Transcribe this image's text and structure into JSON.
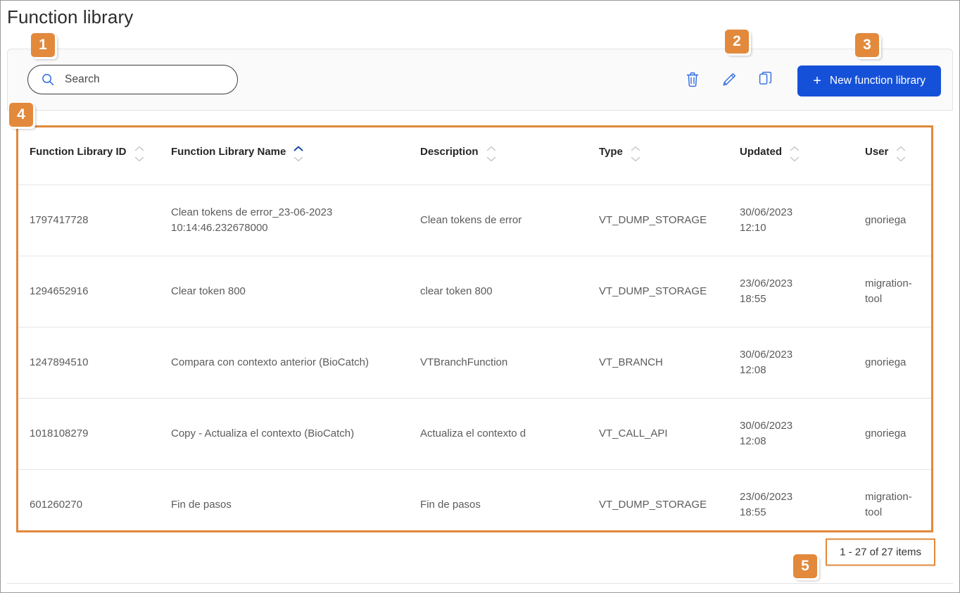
{
  "page": {
    "title": "Function library"
  },
  "colors": {
    "accent_orange": "#e2893c",
    "primary_blue": "#1551d8",
    "icon_blue": "#2d6ae0",
    "text_dark": "#2c2c2c",
    "text_body": "#5b5b5b"
  },
  "search": {
    "placeholder": "Search",
    "value": "",
    "icon": "search-icon"
  },
  "toolbar": {
    "icons": [
      {
        "name": "delete-icon",
        "label": "Delete"
      },
      {
        "name": "edit-icon",
        "label": "Edit"
      },
      {
        "name": "copy-icon",
        "label": "Copy"
      }
    ],
    "new_button": {
      "plus": "+",
      "label": "New function library"
    }
  },
  "table": {
    "columns": [
      {
        "key": "id",
        "label": "Function Library ID",
        "sorted": "none"
      },
      {
        "key": "name",
        "label": "Function Library Name",
        "sorted": "asc"
      },
      {
        "key": "desc",
        "label": "Description",
        "sorted": "none"
      },
      {
        "key": "type",
        "label": "Type",
        "sorted": "none"
      },
      {
        "key": "updated",
        "label": "Updated",
        "sorted": "none"
      },
      {
        "key": "user",
        "label": "User",
        "sorted": "none"
      }
    ],
    "rows": [
      {
        "id": "1797417728",
        "name": "Clean tokens de error_23-06-2023 10:14:46.232678000",
        "desc": "Clean tokens de error",
        "type": "VT_DUMP_STORAGE",
        "updated_date": "30/06/2023",
        "updated_time": "12:10",
        "user": "gnoriega"
      },
      {
        "id": "1294652916",
        "name": "Clear token 800",
        "desc": "clear token 800",
        "type": "VT_DUMP_STORAGE",
        "updated_date": "23/06/2023",
        "updated_time": "18:55",
        "user": "migration-tool"
      },
      {
        "id": "1247894510",
        "name": "Compara con contexto anterior (BioCatch)",
        "desc": "VTBranchFunction",
        "type": "VT_BRANCH",
        "updated_date": "30/06/2023",
        "updated_time": "12:08",
        "user": "gnoriega"
      },
      {
        "id": "1018108279",
        "name": "Copy - Actualiza el contexto (BioCatch)",
        "desc": "Actualiza el contexto d",
        "type": "VT_CALL_API",
        "updated_date": "30/06/2023",
        "updated_time": "12:08",
        "user": "gnoriega"
      },
      {
        "id": "601260270",
        "name": "Fin de pasos",
        "desc": "Fin de pasos",
        "type": "VT_DUMP_STORAGE",
        "updated_date": "23/06/2023",
        "updated_time": "18:55",
        "user": "migration-tool"
      }
    ]
  },
  "pagination": {
    "summary": "1 - 27 of 27 items"
  },
  "callouts": [
    {
      "number": "1",
      "target": "search-input"
    },
    {
      "number": "2",
      "target": "toolbar-action-icons"
    },
    {
      "number": "3",
      "target": "new-function-library-button"
    },
    {
      "number": "4",
      "target": "function-library-table"
    },
    {
      "number": "5",
      "target": "pagination-summary"
    }
  ]
}
